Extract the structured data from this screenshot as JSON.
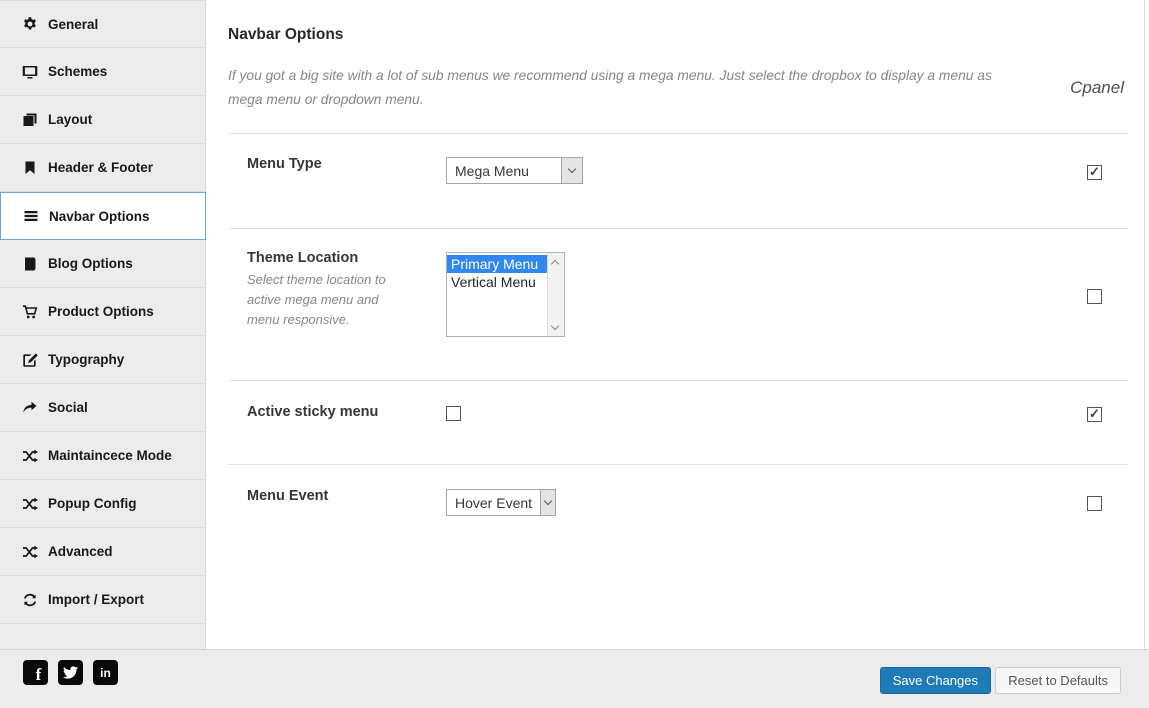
{
  "sidebar": {
    "items": [
      {
        "label": "General",
        "icon": "gear",
        "active": false
      },
      {
        "label": "Schemes",
        "icon": "display",
        "active": false
      },
      {
        "label": "Layout",
        "icon": "layers",
        "active": false
      },
      {
        "label": "Header & Footer",
        "icon": "header-footer",
        "active": false
      },
      {
        "label": "Navbar Options",
        "icon": "hamburger",
        "active": true
      },
      {
        "label": "Blog Options",
        "icon": "book",
        "active": false
      },
      {
        "label": "Product Options",
        "icon": "cart",
        "active": false
      },
      {
        "label": "Typography",
        "icon": "edit",
        "active": false
      },
      {
        "label": "Social",
        "icon": "share",
        "active": false
      },
      {
        "label": "Maintaincece Mode",
        "icon": "shuffle",
        "active": false
      },
      {
        "label": "Popup Config",
        "icon": "shuffle",
        "active": false
      },
      {
        "label": "Advanced",
        "icon": "shuffle",
        "active": false
      },
      {
        "label": "Import / Export",
        "icon": "sync",
        "active": false
      }
    ]
  },
  "header": {
    "title": "Navbar Options",
    "description": "If you got a big site with a lot of sub menus we recommend using a mega menu. Just select the dropbox to display a menu as mega menu or dropdown menu.",
    "brand": "Cpanel"
  },
  "rows": [
    {
      "label": "Menu Type",
      "control": "select",
      "value": "Mega Menu",
      "right_checked": true
    },
    {
      "label": "Theme Location",
      "description": "Select theme location to active mega menu and menu responsive.",
      "control": "listbox",
      "options": [
        "Primary Menu",
        "Vertical Menu"
      ],
      "selected": "Primary Menu",
      "right_checked": false
    },
    {
      "label": "Active sticky menu",
      "control": "checkbox",
      "checked": false,
      "right_checked": true
    },
    {
      "label": "Menu Event",
      "control": "select",
      "value": "Hover Event",
      "right_checked": false
    }
  ],
  "footer": {
    "save_label": "Save Changes",
    "reset_label": "Reset to Defaults",
    "social": [
      {
        "name": "facebook",
        "glyph": "f"
      },
      {
        "name": "twitter"
      },
      {
        "name": "linkedin",
        "glyph": "in"
      }
    ]
  },
  "colors": {
    "sidebar_bg": "#ececec",
    "active_item_border": "#6ea5d8",
    "listbox_selection": "#2f87f0",
    "save_button": "#1e7bb7",
    "divider": "#e2e2e2"
  }
}
